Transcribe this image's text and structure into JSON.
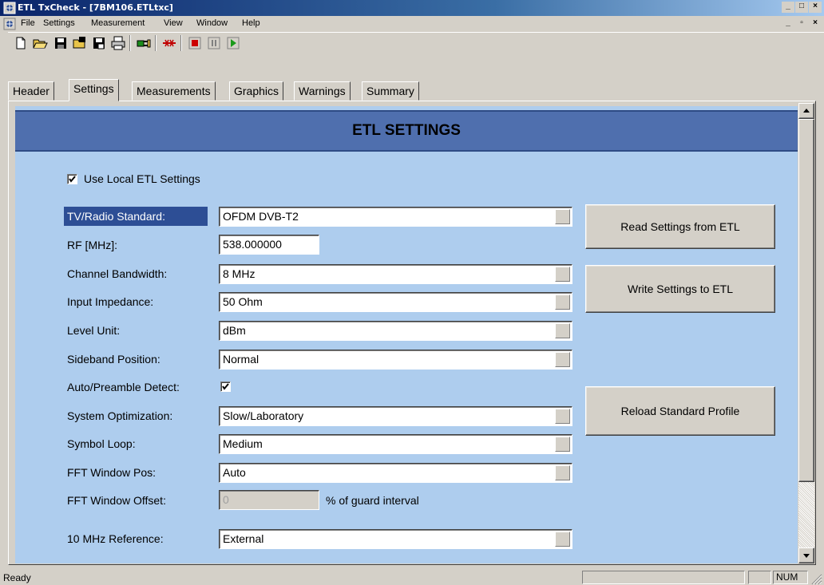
{
  "window": {
    "title": "ETL TxCheck - [7BM106.ETLtxc]",
    "caption_buttons": [
      "_",
      "□",
      "X"
    ],
    "mdi_buttons": [
      "_",
      "ð",
      "X"
    ]
  },
  "menu": [
    "File",
    "Settings",
    "Measurement",
    "View",
    "Window",
    "Help"
  ],
  "toolbar": {
    "icons": [
      "new-icon",
      "open-icon",
      "save-icon",
      "open-folder-icon",
      "save-all-icon",
      "print-icon",
      "connect-icon",
      "disconnect-icon",
      "stop-icon",
      "pause-icon",
      "play-icon"
    ]
  },
  "tabs": [
    {
      "label": "Header",
      "active": false
    },
    {
      "label": "Settings",
      "active": true
    },
    {
      "label": "Measurements",
      "active": false
    },
    {
      "label": "Graphics",
      "active": false
    },
    {
      "label": "Warnings",
      "active": false
    },
    {
      "label": "Summary",
      "active": false
    }
  ],
  "settings": {
    "banner": "ETL SETTINGS",
    "use_local": {
      "label": "Use Local ETL Settings",
      "checked": true
    },
    "fields": {
      "standard": {
        "label": "TV/Radio Standard:",
        "value": "OFDM DVB-T2"
      },
      "rf": {
        "label": "RF [MHz]:",
        "value": "538.000000"
      },
      "bandwidth": {
        "label": "Channel Bandwidth:",
        "value": "8 MHz"
      },
      "impedance": {
        "label": "Input Impedance:",
        "value": "50 Ohm"
      },
      "level_unit": {
        "label": "Level Unit:",
        "value": "dBm"
      },
      "sideband": {
        "label": "Sideband Position:",
        "value": "Normal"
      },
      "auto_preamble": {
        "label": "Auto/Preamble Detect:",
        "checked": true
      },
      "optimization": {
        "label": "System Optimization:",
        "value": "Slow/Laboratory"
      },
      "symbol_loop": {
        "label": "Symbol Loop:",
        "value": "Medium"
      },
      "fft_pos": {
        "label": "FFT Window Pos:",
        "value": "Auto"
      },
      "fft_offset": {
        "label": "FFT Window Offset:",
        "value": "0",
        "suffix": "% of guard interval"
      },
      "ref_10mhz": {
        "label": "10 MHz Reference:",
        "value": "External"
      }
    },
    "buttons": {
      "read": "Read Settings from ETL",
      "write": "Write Settings to ETL",
      "reload": "Reload Standard Profile"
    }
  },
  "status": {
    "text": "Ready",
    "num": "NUM"
  },
  "colors": {
    "pane_bg": "#aecdee",
    "banner_bg": "#4f6fae",
    "selection": "#2d4e95"
  }
}
